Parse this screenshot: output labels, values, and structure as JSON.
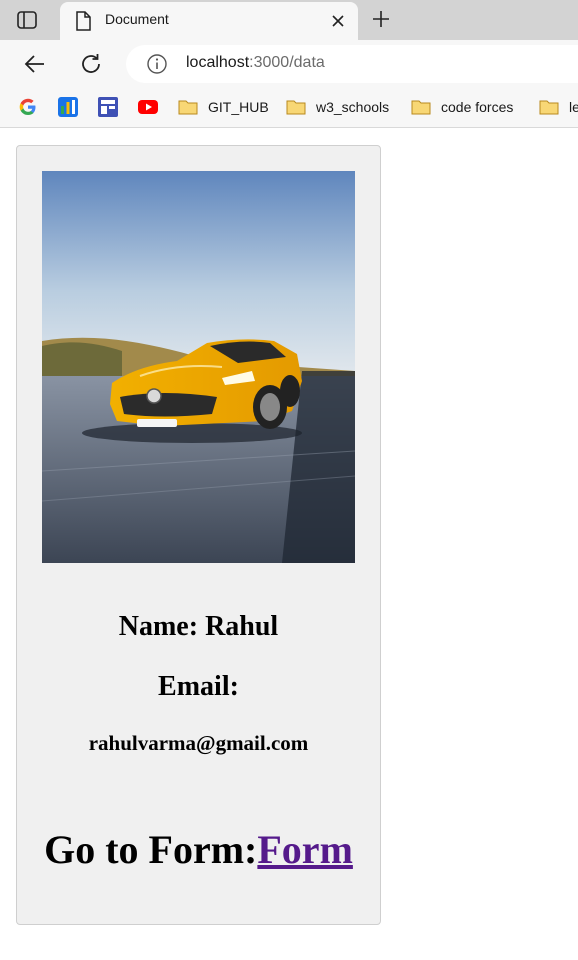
{
  "browser": {
    "tab": {
      "title": "Document"
    },
    "address": {
      "host": "localhost",
      "path": ":3000/data"
    },
    "bookmarks": [
      {
        "label": "",
        "icon": "google-icon"
      },
      {
        "label": "",
        "icon": "analytics-icon"
      },
      {
        "label": "",
        "icon": "layout-icon"
      },
      {
        "label": "",
        "icon": "youtube-icon"
      },
      {
        "label": "GIT_HUB",
        "icon": "folder-icon"
      },
      {
        "label": "w3_schools",
        "icon": "folder-icon"
      },
      {
        "label": "code forces",
        "icon": "folder-icon"
      },
      {
        "label": "le",
        "icon": "folder-icon"
      }
    ]
  },
  "profile": {
    "image_subject": "yellow sports car on road",
    "name_line": "Name: Rahul",
    "email_label": "Email:",
    "email_value": "rahulvarma@gmail.com",
    "form_prefix": "Go to Form:",
    "form_link": "Form"
  },
  "colors": {
    "link_visited": "#551a8b",
    "card_bg": "#f0f0f0",
    "chrome_bg": "#f7f7f7",
    "tabbar_bg": "#d3d3d3"
  }
}
